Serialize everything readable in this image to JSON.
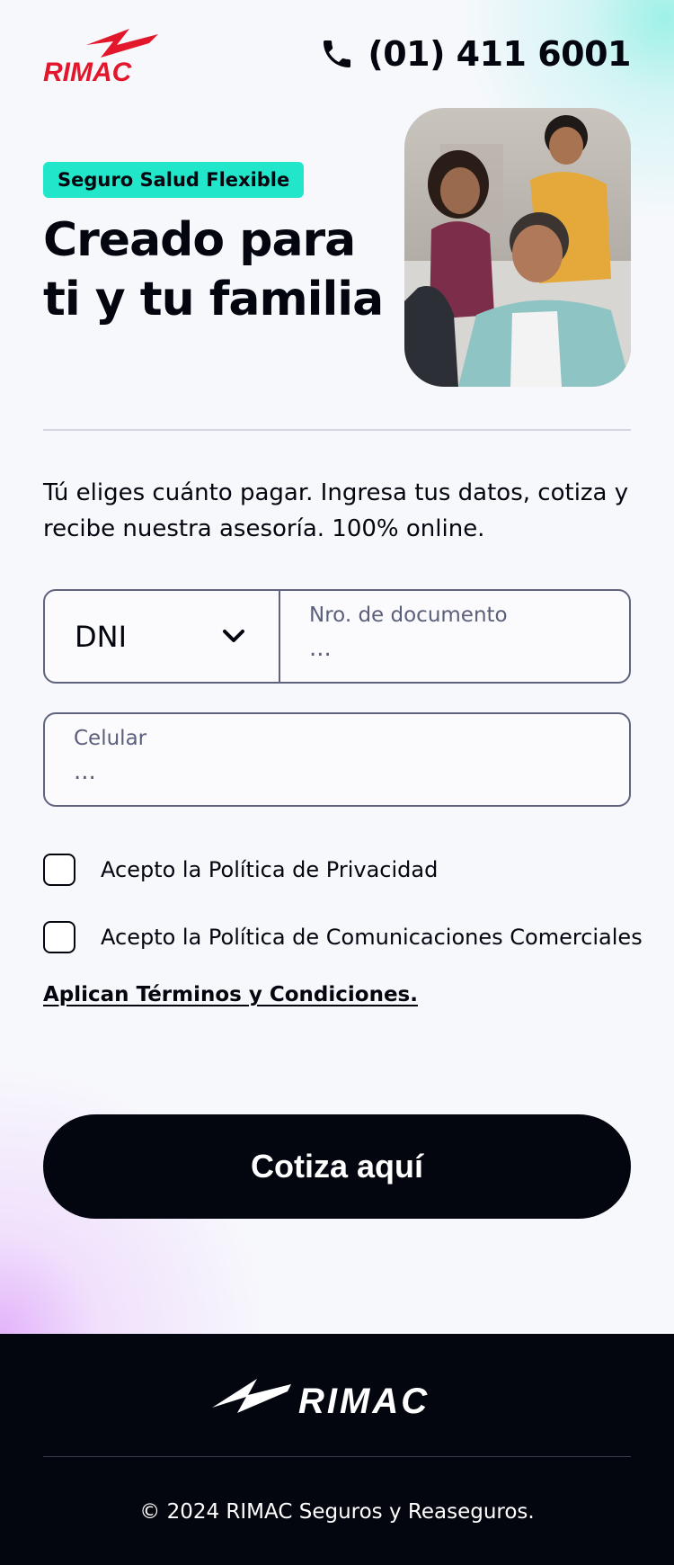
{
  "header": {
    "logo_text": "RIMAC",
    "phone_number": "(01) 411 6001"
  },
  "hero": {
    "badge": "Seguro Salud Flexible",
    "title_line1": "Creado para",
    "title_line2": "ti y tu familia",
    "image_icon": "family-photo"
  },
  "intro": "Tú eliges cuánto pagar. Ingresa tus datos, cotiza y recibe nuestra asesoría. 100% online.",
  "form": {
    "doc_type": "DNI",
    "doc_number_label": "Nro. de documento",
    "doc_number_placeholder": "...",
    "phone_label": "Celular",
    "phone_placeholder": "...",
    "privacy_label": "Acepto la Política de Privacidad",
    "commercial_label": "Acepto la Política de Comunicaciones Comerciales",
    "terms_link": "Aplican Términos y Condiciones.",
    "submit_label": "Cotiza aquí"
  },
  "footer": {
    "logo_text": "RIMAC",
    "copyright": "© 2024 RIMAC Seguros y Reaseguros."
  },
  "colors": {
    "brand_red": "#e3172b",
    "accent_teal": "#22e6c9",
    "dark": "#03050f"
  }
}
